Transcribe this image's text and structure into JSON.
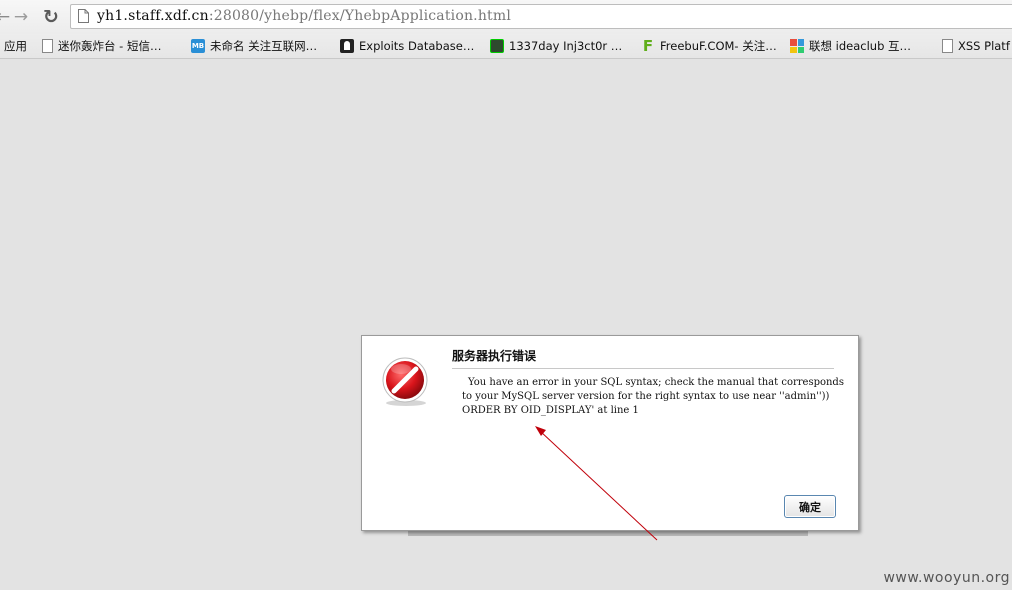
{
  "browser": {
    "url_host": "yh1.staff.xdf.cn",
    "url_rest": ":28080/yhebp/flex/YhebpApplication.html"
  },
  "bookmarks": {
    "apps_label": "应用",
    "items": [
      {
        "label": "迷你轰炸台 - 短信…",
        "icon": "page-icon"
      },
      {
        "label": "未命名 关注互联网…",
        "icon": "mb-icon"
      },
      {
        "label": "Exploits Database…",
        "icon": "person-icon"
      },
      {
        "label": "1337day Inj3ct0r …",
        "icon": "1337-icon"
      },
      {
        "label": "FreebuF.COM- 关注…",
        "icon": "freebuf-icon"
      },
      {
        "label": "联想 ideaclub 互…",
        "icon": "lenovo-icon"
      },
      {
        "label": "XSS Platf",
        "icon": "page-icon"
      }
    ]
  },
  "dialog": {
    "title": "服务器执行错误",
    "message": "You have an error in your SQL syntax; check the manual that corresponds to your MySQL server version for the right syntax to use near ''admin''))  ORDER BY OID_DISPLAY' at line 1",
    "ok_label": "确定",
    "icon": "error-icon"
  },
  "annotation": {
    "color": "#c0000a"
  },
  "watermark": "www.wooyun.org"
}
